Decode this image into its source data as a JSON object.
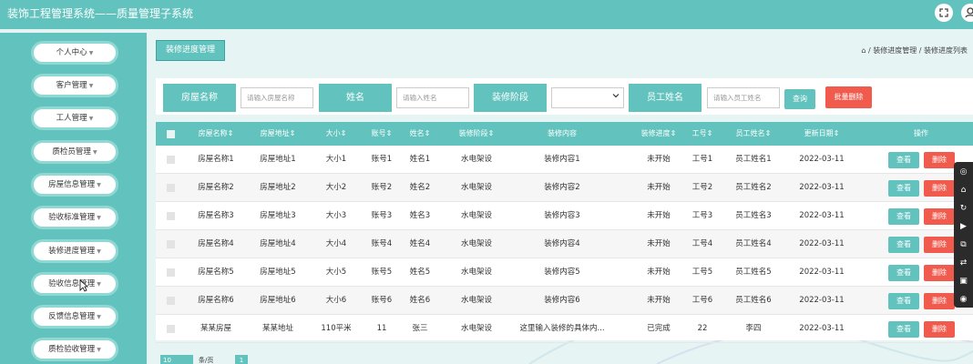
{
  "app": {
    "title": "装饰工程管理系统——质量管理子系统"
  },
  "header_icons": [
    "fullscreen-icon",
    "user-icon"
  ],
  "sidebar": {
    "items": [
      {
        "label": "个人中心"
      },
      {
        "label": "客户管理"
      },
      {
        "label": "工人管理"
      },
      {
        "label": "质检员管理"
      },
      {
        "label": "房屋信息管理"
      },
      {
        "label": "验收标准管理"
      },
      {
        "label": "装修进度管理"
      },
      {
        "label": "验收信息管理"
      },
      {
        "label": "反馈信息管理"
      },
      {
        "label": "质检验收管理"
      }
    ],
    "caret": "▼"
  },
  "page": {
    "tab_label": "装修进度管理",
    "breadcrumb": "⌂ / 装修进度管理 / 装修进度列表"
  },
  "search": {
    "house_label": "房屋名称",
    "house_placeholder": "请输入房屋名称",
    "name_label": "姓名",
    "name_placeholder": "请输入姓名",
    "stage_label": "装修阶段",
    "stage_value": "",
    "worker_label": "员工姓名",
    "worker_placeholder": "请输入员工姓名",
    "query_button": "查询",
    "bulk_delete_button": "批量删除"
  },
  "table": {
    "headers": [
      "房屋名称",
      "房屋地址",
      "大小",
      "账号",
      "姓名",
      "装修阶段",
      "装修内容",
      "装修进度",
      "工号",
      "员工姓名",
      "更新日期",
      "操作"
    ],
    "sort_mark": "⇕",
    "view_label": "查看",
    "delete_label": "删除",
    "rows": [
      [
        "房屋名称1",
        "房屋地址1",
        "大小1",
        "账号1",
        "姓名1",
        "水电架设",
        "装修内容1",
        "未开始",
        "工号1",
        "员工姓名1",
        "2022-03-11"
      ],
      [
        "房屋名称2",
        "房屋地址2",
        "大小2",
        "账号2",
        "姓名2",
        "水电架设",
        "装修内容2",
        "未开始",
        "工号2",
        "员工姓名2",
        "2022-03-11"
      ],
      [
        "房屋名称3",
        "房屋地址3",
        "大小3",
        "账号3",
        "姓名3",
        "水电架设",
        "装修内容3",
        "未开始",
        "工号3",
        "员工姓名3",
        "2022-03-11"
      ],
      [
        "房屋名称4",
        "房屋地址4",
        "大小4",
        "账号4",
        "姓名4",
        "水电架设",
        "装修内容4",
        "未开始",
        "工号4",
        "员工姓名4",
        "2022-03-11"
      ],
      [
        "房屋名称5",
        "房屋地址5",
        "大小5",
        "账号5",
        "姓名5",
        "水电架设",
        "装修内容5",
        "未开始",
        "工号5",
        "员工姓名5",
        "2022-03-11"
      ],
      [
        "房屋名称6",
        "房屋地址6",
        "大小6",
        "账号6",
        "姓名6",
        "水电架设",
        "装修内容6",
        "未开始",
        "工号6",
        "员工姓名6",
        "2022-03-11"
      ],
      [
        "某某房屋",
        "某某地址",
        "110平米",
        "11",
        "张三",
        "水电架设",
        "这里输入装修的具体内...",
        "已完成",
        "22",
        "李四",
        "2022-03-11"
      ]
    ]
  },
  "pagination": {
    "page_size": "10",
    "unit": "条/页",
    "current_page": "1"
  },
  "colors": {
    "primary": "#62c3be",
    "danger": "#f05b4e",
    "background": "#e6f4f3"
  }
}
